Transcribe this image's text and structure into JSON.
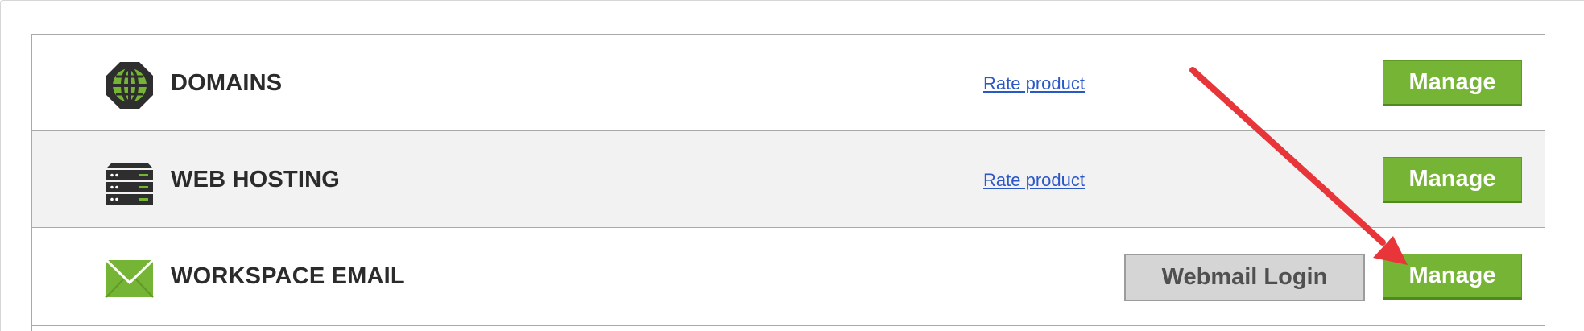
{
  "products": [
    {
      "title": "DOMAINS",
      "icon": "globe-icon",
      "rate_label": "Rate product",
      "manage_label": "Manage"
    },
    {
      "title": "WEB HOSTING",
      "icon": "server-icon",
      "rate_label": "Rate product",
      "manage_label": "Manage"
    },
    {
      "title": "WORKSPACE EMAIL",
      "icon": "envelope-icon",
      "webmail_label": "Webmail Login",
      "manage_label": "Manage"
    }
  ],
  "colors": {
    "accent_green": "#76b435",
    "link_blue": "#2b58c7",
    "annotation_arrow": "#e8353a"
  }
}
